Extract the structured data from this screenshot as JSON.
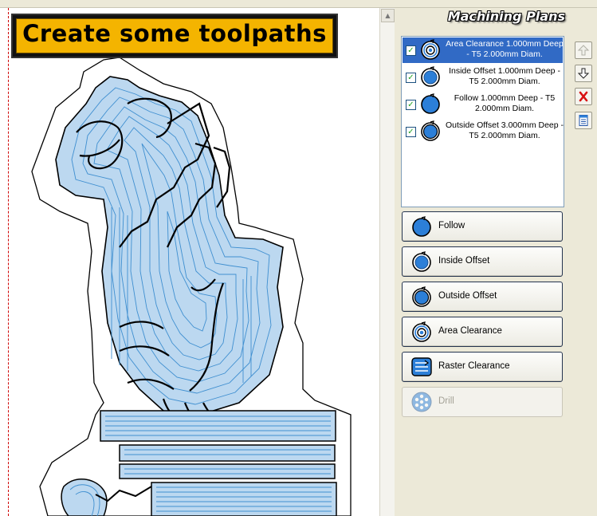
{
  "banner": {
    "text": "Create some toolpaths"
  },
  "panel": {
    "title": "Machining Plans",
    "plans": [
      {
        "label": "Area Clearance 1.000mm Deep - T5 2.000mm Diam.",
        "checked": true,
        "selected": true,
        "icon": "area-clearance-icon"
      },
      {
        "label": "Inside Offset 1.000mm Deep - T5 2.000mm Diam.",
        "checked": true,
        "selected": false,
        "icon": "inside-offset-icon"
      },
      {
        "label": "Follow 1.000mm Deep - T5 2.000mm Diam.",
        "checked": true,
        "selected": false,
        "icon": "follow-icon"
      },
      {
        "label": "Outside Offset 3.000mm Deep - T5 2.000mm Diam.",
        "checked": true,
        "selected": false,
        "icon": "outside-offset-icon"
      }
    ],
    "side_buttons": [
      {
        "name": "move-up-button",
        "icon": "arrow-up-icon",
        "enabled": false
      },
      {
        "name": "move-down-button",
        "icon": "arrow-down-icon",
        "enabled": true
      },
      {
        "name": "delete-button",
        "icon": "red-x-icon",
        "enabled": true
      },
      {
        "name": "properties-button",
        "icon": "document-icon",
        "enabled": true
      }
    ],
    "tools": [
      {
        "label": "Follow",
        "icon": "follow-icon",
        "enabled": true
      },
      {
        "label": "Inside Offset",
        "icon": "inside-offset-icon",
        "enabled": true
      },
      {
        "label": "Outside Offset",
        "icon": "outside-offset-icon",
        "enabled": true
      },
      {
        "label": "Area Clearance",
        "icon": "area-clearance-icon",
        "enabled": true
      },
      {
        "label": "Raster Clearance",
        "icon": "raster-clearance-icon",
        "enabled": true
      },
      {
        "label": "Drill",
        "icon": "drill-icon",
        "enabled": false
      }
    ]
  },
  "colors": {
    "selection": "#316ac5",
    "toolpath": "#3f8fd0",
    "toolpath_fill": "#bcd8f0",
    "guide_line": "#d00000",
    "banner": "#f4b400"
  }
}
